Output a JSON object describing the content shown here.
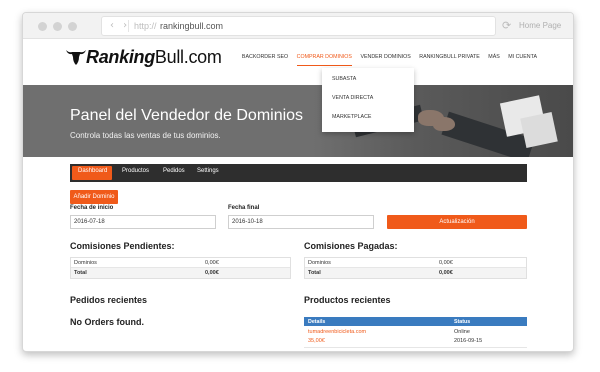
{
  "browser": {
    "nav_arrows": "‹ ›",
    "url_protocol": "http://",
    "url": "rankingbull.com",
    "reload_icon": "reload-icon",
    "home_label": "Home Page"
  },
  "site": {
    "logo_bold": "Ranking",
    "logo_rest": "Bull.com",
    "nav": [
      "BACKORDER SEO",
      "COMPRAR DOMINIOS",
      "VENDER DOMINIOS",
      "RANKINGBULL PRIVATE",
      "MÁS",
      "MI CUENTA"
    ],
    "dropdown": [
      "SUBASTA",
      "VENTA DIRECTA",
      "MARKETPLACE"
    ]
  },
  "hero": {
    "title": "Panel del Vendedor de Dominios",
    "subtitle": "Controla todas las ventas de tus dominios."
  },
  "tabs": [
    "Dashboard",
    "Productos",
    "Pedidos",
    "Settings"
  ],
  "add_domain_label": "Añadir Dominio",
  "filters": {
    "start_label": "Fecha de inicio",
    "start_value": "2016-07-18",
    "end_label": "Fecha final",
    "end_value": "2016-10-18",
    "update_label": "Actualización"
  },
  "pending": {
    "title": "Comisiones Pendientes:",
    "rows": [
      [
        "Dominios",
        "0,00€"
      ],
      [
        "Total",
        "0,00€"
      ]
    ]
  },
  "paid": {
    "title": "Comisiones Pagadas:",
    "rows": [
      [
        "Dominios",
        "0,00€"
      ],
      [
        "Total",
        "0,00€"
      ]
    ]
  },
  "orders": {
    "title": "Pedidos recientes",
    "empty": "No Orders found."
  },
  "products": {
    "title": "Productos recientes",
    "headers": [
      "Details",
      "Status"
    ],
    "rows": [
      {
        "name": "tumadreenbicicleta.com",
        "price": "35,00€",
        "status": "Online",
        "date": "2016-09-15"
      }
    ]
  },
  "colors": {
    "accent": "#f05a1a",
    "dark_bar": "#2e2e2e",
    "table_head": "#3a7bbf"
  }
}
